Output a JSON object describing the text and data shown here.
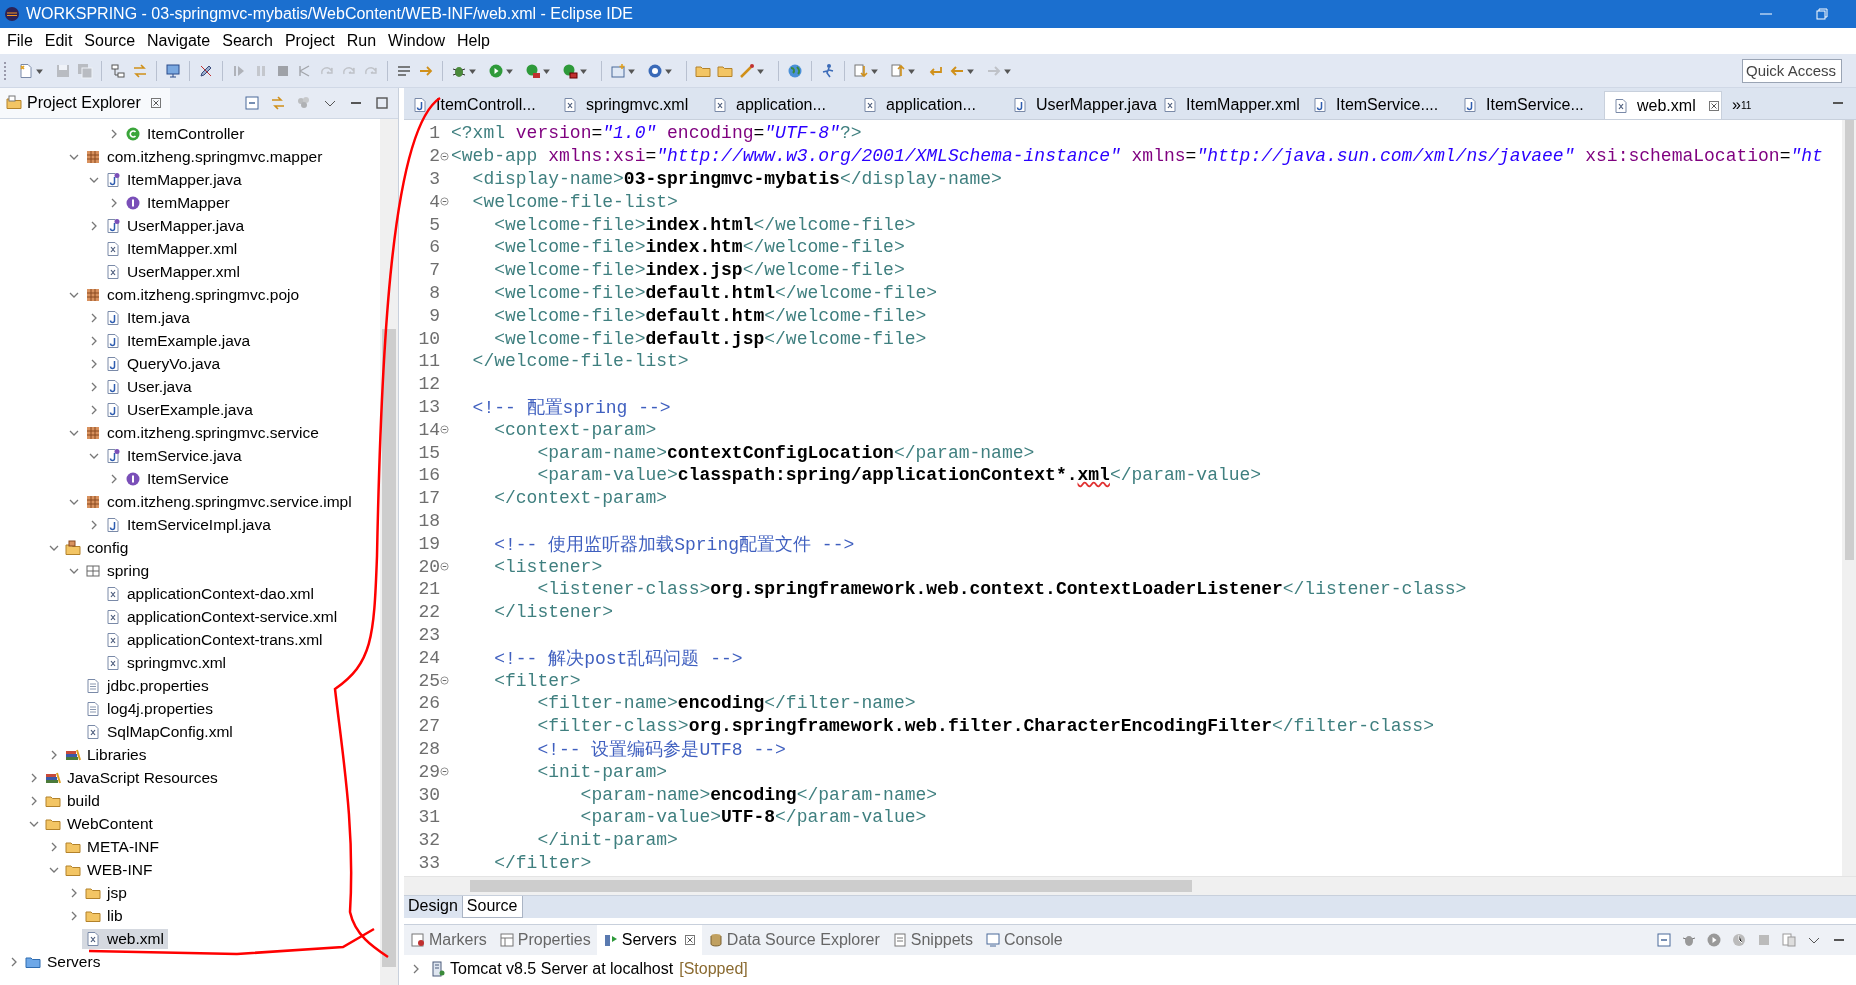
{
  "window": {
    "title": "WORKSPRING - 03-springmvc-mybatis/WebContent/WEB-INF/web.xml - Eclipse IDE"
  },
  "menu": [
    "File",
    "Edit",
    "Source",
    "Navigate",
    "Search",
    "Project",
    "Run",
    "Window",
    "Help"
  ],
  "toolbar": [
    {
      "kind": "new",
      "disabled": false,
      "menu": true
    },
    {
      "kind": "save",
      "disabled": true,
      "menu": false
    },
    {
      "kind": "save-all",
      "disabled": true,
      "menu": false
    },
    {
      "kind": "separator"
    },
    {
      "kind": "hierarchy",
      "disabled": false,
      "menu": false
    },
    {
      "kind": "swap",
      "disabled": false,
      "menu": false
    },
    {
      "kind": "separator"
    },
    {
      "kind": "monitor",
      "disabled": false,
      "menu": false
    },
    {
      "kind": "separator"
    },
    {
      "kind": "pencil",
      "disabled": false,
      "menu": false
    },
    {
      "kind": "separator"
    },
    {
      "kind": "resume",
      "disabled": true,
      "menu": false
    },
    {
      "kind": "pause",
      "disabled": true,
      "menu": false
    },
    {
      "kind": "stop",
      "disabled": true,
      "menu": false
    },
    {
      "kind": "branch",
      "disabled": true,
      "menu": false
    },
    {
      "kind": "step",
      "disabled": true,
      "menu": false
    },
    {
      "kind": "step",
      "disabled": true,
      "menu": false
    },
    {
      "kind": "step",
      "disabled": true,
      "menu": false
    },
    {
      "kind": "separator"
    },
    {
      "kind": "list",
      "disabled": false,
      "menu": false
    },
    {
      "kind": "arrow",
      "disabled": false,
      "menu": false
    },
    {
      "kind": "separator"
    },
    {
      "kind": "bug",
      "disabled": false,
      "menu": true
    },
    {
      "kind": "run",
      "disabled": false,
      "menu": true
    },
    {
      "kind": "coverage",
      "disabled": false,
      "menu": true
    },
    {
      "kind": "tools",
      "disabled": false,
      "menu": true
    },
    {
      "kind": "separator"
    },
    {
      "kind": "add",
      "disabled": false,
      "menu": true
    },
    {
      "kind": "circle",
      "disabled": false,
      "menu": true
    },
    {
      "kind": "separator"
    },
    {
      "kind": "folder",
      "disabled": false,
      "menu": false
    },
    {
      "kind": "folder",
      "disabled": false,
      "menu": false
    },
    {
      "kind": "wand",
      "disabled": false,
      "menu": true
    },
    {
      "kind": "separator"
    },
    {
      "kind": "globe",
      "disabled": false,
      "menu": false
    },
    {
      "kind": "separator"
    },
    {
      "kind": "figure",
      "disabled": false,
      "menu": false
    },
    {
      "kind": "separator"
    },
    {
      "kind": "down",
      "disabled": false,
      "menu": true
    },
    {
      "kind": "up",
      "disabled": false,
      "menu": true
    },
    {
      "kind": "return",
      "disabled": false,
      "menu": false
    },
    {
      "kind": "back",
      "disabled": false,
      "menu": true
    },
    {
      "kind": "forward",
      "disabled": true,
      "menu": true
    }
  ],
  "quick_access": {
    "placeholder": "Quick Access"
  },
  "project_explorer": {
    "title": "Project Explorer",
    "tree": [
      {
        "children": [
          {
            "children": [
              {
                "children": [
                  {
                    "children": [
                      {
                        "children": [
                          {
                            "label": "ItemController",
                            "kind": "class",
                            "expanded": false,
                            "selected": false
                          }
                        ]
                      }
                    ]
                  },
                  {
                    "label": "com.itzheng.springmvc.mapper",
                    "kind": "package",
                    "expanded": true,
                    "selected": false,
                    "children": [
                      {
                        "label": "ItemMapper.java",
                        "kind": "interface-file",
                        "expanded": true,
                        "selected": false,
                        "children": [
                          {
                            "label": "ItemMapper",
                            "kind": "interface",
                            "expanded": false,
                            "selected": false
                          }
                        ]
                      },
                      {
                        "label": "UserMapper.java",
                        "kind": "interface-file",
                        "expanded": false,
                        "selected": false
                      },
                      {
                        "label": "ItemMapper.xml",
                        "kind": "xml",
                        "selected": false
                      },
                      {
                        "label": "UserMapper.xml",
                        "kind": "xml",
                        "selected": false
                      }
                    ]
                  },
                  {
                    "label": "com.itzheng.springmvc.pojo",
                    "kind": "package",
                    "expanded": true,
                    "selected": false,
                    "children": [
                      {
                        "label": "Item.java",
                        "kind": "java",
                        "expanded": false,
                        "selected": false
                      },
                      {
                        "label": "ItemExample.java",
                        "kind": "java",
                        "expanded": false,
                        "selected": false
                      },
                      {
                        "label": "QueryVo.java",
                        "kind": "java",
                        "expanded": false,
                        "selected": false
                      },
                      {
                        "label": "User.java",
                        "kind": "java",
                        "expanded": false,
                        "selected": false
                      },
                      {
                        "label": "UserExample.java",
                        "kind": "java",
                        "expanded": false,
                        "selected": false
                      }
                    ]
                  },
                  {
                    "label": "com.itzheng.springmvc.service",
                    "kind": "package",
                    "expanded": true,
                    "selected": false,
                    "children": [
                      {
                        "label": "ItemService.java",
                        "kind": "interface-file",
                        "expanded": true,
                        "selected": false,
                        "children": [
                          {
                            "label": "ItemService",
                            "kind": "interface",
                            "expanded": false,
                            "selected": false
                          }
                        ]
                      }
                    ]
                  },
                  {
                    "label": "com.itzheng.springmvc.service.impl",
                    "kind": "package",
                    "expanded": true,
                    "selected": false,
                    "children": [
                      {
                        "label": "ItemServiceImpl.java",
                        "kind": "java",
                        "expanded": false,
                        "selected": false
                      }
                    ]
                  }
                ]
              },
              {
                "label": "config",
                "kind": "source-folder",
                "expanded": true,
                "selected": false,
                "children": [
                  {
                    "label": "spring",
                    "kind": "package-folder",
                    "expanded": true,
                    "selected": false,
                    "children": [
                      {
                        "label": "applicationContext-dao.xml",
                        "kind": "xml",
                        "selected": false
                      },
                      {
                        "label": "applicationContext-service.xml",
                        "kind": "xml",
                        "selected": false
                      },
                      {
                        "label": "applicationContext-trans.xml",
                        "kind": "xml",
                        "selected": false
                      },
                      {
                        "label": "springmvc.xml",
                        "kind": "xml",
                        "selected": false
                      }
                    ]
                  },
                  {
                    "label": "jdbc.properties",
                    "kind": "properties",
                    "selected": false
                  },
                  {
                    "label": "log4j.properties",
                    "kind": "properties",
                    "selected": false
                  },
                  {
                    "label": "SqlMapConfig.xml",
                    "kind": "xml",
                    "selected": false
                  }
                ]
              },
              {
                "label": "Libraries",
                "kind": "library",
                "expanded": false,
                "selected": false
              }
            ]
          },
          {
            "label": "JavaScript Resources",
            "kind": "library",
            "expanded": false,
            "selected": false
          },
          {
            "label": "build",
            "kind": "folder",
            "expanded": false,
            "selected": false
          },
          {
            "label": "WebContent",
            "kind": "folder",
            "expanded": true,
            "selected": false,
            "children": [
              {
                "label": "META-INF",
                "kind": "folder",
                "expanded": false,
                "selected": false
              },
              {
                "label": "WEB-INF",
                "kind": "folder",
                "expanded": true,
                "selected": false,
                "children": [
                  {
                    "label": "jsp",
                    "kind": "folder",
                    "expanded": false,
                    "selected": false
                  },
                  {
                    "label": "lib",
                    "kind": "folder",
                    "expanded": false,
                    "selected": false
                  },
                  {
                    "label": "web.xml",
                    "kind": "xml",
                    "selected": true
                  }
                ]
              }
            ]
          }
        ]
      },
      {
        "label": "Servers",
        "kind": "server-folder",
        "expanded": false,
        "selected": false
      }
    ]
  },
  "editor": {
    "tabs": [
      {
        "label": "ItemControll...",
        "kind": "java",
        "selected": false
      },
      {
        "label": "springmvc.xml",
        "kind": "xml",
        "selected": false
      },
      {
        "label": "application...",
        "kind": "xml",
        "selected": false
      },
      {
        "label": "application...",
        "kind": "xml",
        "selected": false
      },
      {
        "label": "UserMapper.java",
        "kind": "java",
        "selected": false
      },
      {
        "label": "ItemMapper.xml",
        "kind": "xml",
        "selected": false
      },
      {
        "label": "ItemService....",
        "kind": "java",
        "selected": false
      },
      {
        "label": "ItemService...",
        "kind": "java",
        "selected": false
      },
      {
        "label": "web.xml",
        "kind": "xml",
        "selected": true
      }
    ],
    "overflow": {
      "label": "»",
      "count": "11"
    },
    "lines": [
      {
        "number": "1",
        "fold": false,
        "parts": [
          {
            "kind": "tag",
            "text": "<?xml"
          },
          {
            "kind": "attr",
            "text": " version"
          },
          {
            "kind": "punct",
            "text": "="
          },
          {
            "kind": "string",
            "text": "\"1.0\""
          },
          {
            "kind": "attr",
            "text": " encoding"
          },
          {
            "kind": "punct",
            "text": "="
          },
          {
            "kind": "string",
            "text": "\"UTF-8\""
          },
          {
            "kind": "tag",
            "text": "?>"
          }
        ]
      },
      {
        "number": "2",
        "fold": true,
        "parts": [
          {
            "kind": "tag",
            "text": "<web-app"
          },
          {
            "kind": "attr",
            "text": " xmlns:xsi"
          },
          {
            "kind": "punct",
            "text": "="
          },
          {
            "kind": "string",
            "text": "\"http://www.w3.org/2001/XMLSchema-instance\""
          },
          {
            "kind": "attr",
            "text": " xmlns"
          },
          {
            "kind": "punct",
            "text": "="
          },
          {
            "kind": "string",
            "text": "\"http://java.sun.com/xml/ns/javaee\""
          },
          {
            "kind": "attr",
            "text": " xsi:schemaLocation"
          },
          {
            "kind": "punct",
            "text": "="
          },
          {
            "kind": "string",
            "text": "\"ht"
          }
        ]
      },
      {
        "number": "3",
        "fold": false,
        "parts": [
          {
            "kind": "tag",
            "text": "  <display-name>"
          },
          {
            "kind": "text",
            "text": "03-springmvc-mybatis"
          },
          {
            "kind": "tag",
            "text": "</display-name>"
          }
        ]
      },
      {
        "number": "4",
        "fold": true,
        "parts": [
          {
            "kind": "tag",
            "text": "  <welcome-file-list>"
          }
        ]
      },
      {
        "number": "5",
        "fold": false,
        "parts": [
          {
            "kind": "tag",
            "text": "    <welcome-file>"
          },
          {
            "kind": "text",
            "text": "index.html"
          },
          {
            "kind": "tag",
            "text": "</welcome-file>"
          }
        ]
      },
      {
        "number": "6",
        "fold": false,
        "parts": [
          {
            "kind": "tag",
            "text": "    <welcome-file>"
          },
          {
            "kind": "text",
            "text": "index.htm"
          },
          {
            "kind": "tag",
            "text": "</welcome-file>"
          }
        ]
      },
      {
        "number": "7",
        "fold": false,
        "parts": [
          {
            "kind": "tag",
            "text": "    <welcome-file>"
          },
          {
            "kind": "text",
            "text": "index.jsp"
          },
          {
            "kind": "tag",
            "text": "</welcome-file>"
          }
        ]
      },
      {
        "number": "8",
        "fold": false,
        "parts": [
          {
            "kind": "tag",
            "text": "    <welcome-file>"
          },
          {
            "kind": "text",
            "text": "default.html"
          },
          {
            "kind": "tag",
            "text": "</welcome-file>"
          }
        ]
      },
      {
        "number": "9",
        "fold": false,
        "parts": [
          {
            "kind": "tag",
            "text": "    <welcome-file>"
          },
          {
            "kind": "text",
            "text": "default.htm"
          },
          {
            "kind": "tag",
            "text": "</welcome-file>"
          }
        ]
      },
      {
        "number": "10",
        "fold": false,
        "parts": [
          {
            "kind": "tag",
            "text": "    <welcome-file>"
          },
          {
            "kind": "text",
            "text": "default.jsp"
          },
          {
            "kind": "tag",
            "text": "</welcome-file>"
          }
        ]
      },
      {
        "number": "11",
        "fold": false,
        "parts": [
          {
            "kind": "tag",
            "text": "  </welcome-file-list>"
          }
        ]
      },
      {
        "number": "12",
        "fold": false
      },
      {
        "number": "13",
        "fold": false,
        "parts": [
          {
            "kind": "comment",
            "text": "  <!-- 配置spring -->"
          }
        ]
      },
      {
        "number": "14",
        "fold": true,
        "parts": [
          {
            "kind": "tag",
            "text": "    <context-param>"
          }
        ]
      },
      {
        "number": "15",
        "fold": false,
        "parts": [
          {
            "kind": "tag",
            "text": "        <param-name>"
          },
          {
            "kind": "text",
            "text": "contextConfigLocation"
          },
          {
            "kind": "tag",
            "text": "</param-name>"
          }
        ]
      },
      {
        "number": "16",
        "fold": false,
        "parts": [
          {
            "kind": "tag",
            "text": "        <param-value>"
          },
          {
            "kind": "text",
            "text": "classpath:spring/applicationContext*."
          },
          {
            "kind": "misspelled",
            "text": "xml"
          },
          {
            "kind": "tag",
            "text": "</param-value>"
          }
        ]
      },
      {
        "number": "17",
        "fold": false,
        "parts": [
          {
            "kind": "tag",
            "text": "    </context-param>"
          }
        ]
      },
      {
        "number": "18",
        "fold": false
      },
      {
        "number": "19",
        "fold": false,
        "parts": [
          {
            "kind": "comment",
            "text": "    <!-- 使用监听器加载Spring配置文件 -->"
          }
        ]
      },
      {
        "number": "20",
        "fold": true,
        "parts": [
          {
            "kind": "tag",
            "text": "    <listener>"
          }
        ]
      },
      {
        "number": "21",
        "fold": false,
        "parts": [
          {
            "kind": "tag",
            "text": "        <listener-class>"
          },
          {
            "kind": "text",
            "text": "org.springframework.web.context.ContextLoaderListener"
          },
          {
            "kind": "tag",
            "text": "</listener-class>"
          }
        ]
      },
      {
        "number": "22",
        "fold": false,
        "parts": [
          {
            "kind": "tag",
            "text": "    </listener>"
          }
        ]
      },
      {
        "number": "23",
        "fold": false
      },
      {
        "number": "24",
        "fold": false,
        "parts": [
          {
            "kind": "comment",
            "text": "    <!-- 解决post乱码问题 -->"
          }
        ]
      },
      {
        "number": "25",
        "fold": true,
        "parts": [
          {
            "kind": "tag",
            "text": "    <filter>"
          }
        ]
      },
      {
        "number": "26",
        "fold": false,
        "parts": [
          {
            "kind": "tag",
            "text": "        <filter-name>"
          },
          {
            "kind": "text",
            "text": "encoding"
          },
          {
            "kind": "tag",
            "text": "</filter-name>"
          }
        ]
      },
      {
        "number": "27",
        "fold": false,
        "parts": [
          {
            "kind": "tag",
            "text": "        <filter-class>"
          },
          {
            "kind": "text",
            "text": "org.springframework.web.filter.CharacterEncodingFilter"
          },
          {
            "kind": "tag",
            "text": "</filter-class>"
          }
        ]
      },
      {
        "number": "28",
        "fold": false,
        "parts": [
          {
            "kind": "comment",
            "text": "        <!-- 设置编码参是UTF8 -->"
          }
        ]
      },
      {
        "number": "29",
        "fold": true,
        "parts": [
          {
            "kind": "tag",
            "text": "        <init-param>"
          }
        ]
      },
      {
        "number": "30",
        "fold": false,
        "parts": [
          {
            "kind": "tag",
            "text": "            <param-name>"
          },
          {
            "kind": "text",
            "text": "encoding"
          },
          {
            "kind": "tag",
            "text": "</param-name>"
          }
        ]
      },
      {
        "number": "31",
        "fold": false,
        "parts": [
          {
            "kind": "tag",
            "text": "            <param-value>"
          },
          {
            "kind": "text",
            "text": "UTF-8"
          },
          {
            "kind": "tag",
            "text": "</param-value>"
          }
        ]
      },
      {
        "number": "32",
        "fold": false,
        "parts": [
          {
            "kind": "tag",
            "text": "        </init-param>"
          }
        ]
      },
      {
        "number": "33",
        "fold": false,
        "parts": [
          {
            "kind": "tag",
            "text": "    </filter>"
          }
        ]
      }
    ],
    "view_tabs": [
      {
        "label": "Design",
        "selected": false
      },
      {
        "label": "Source",
        "selected": true
      }
    ]
  },
  "bottom_panel": {
    "tabs": [
      {
        "label": "Markers",
        "kind": "markers",
        "selected": false
      },
      {
        "label": "Properties",
        "kind": "properties",
        "selected": false
      },
      {
        "label": "Servers",
        "kind": "servers",
        "selected": true
      },
      {
        "label": "Data Source Explorer",
        "kind": "data-source",
        "selected": false
      },
      {
        "label": "Snippets",
        "kind": "snippets",
        "selected": false
      },
      {
        "label": "Console",
        "kind": "console",
        "selected": false
      }
    ],
    "servers": [
      {
        "name": "Tomcat v8.5 Server at localhost",
        "state": "[Stopped]",
        "expanded": false
      }
    ]
  }
}
